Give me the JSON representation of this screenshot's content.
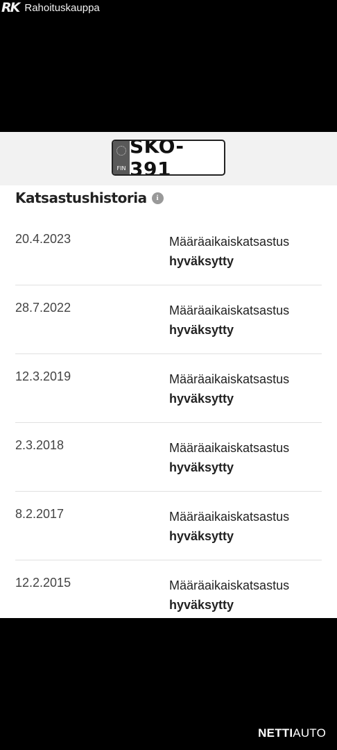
{
  "header": {
    "logo_mark": "RK",
    "logo_text": "Rahoituskauppa"
  },
  "plate": {
    "country": "FIN",
    "number": "SKO-391"
  },
  "section": {
    "title": "Katsastushistoria",
    "info_icon": "info-icon"
  },
  "inspections": [
    {
      "date": "20.4.2023",
      "type": "Määräaikaiskatsastus",
      "status": "hyväksytty"
    },
    {
      "date": "28.7.2022",
      "type": "Määräaikaiskatsastus",
      "status": "hyväksytty"
    },
    {
      "date": "12.3.2019",
      "type": "Määräaikaiskatsastus",
      "status": "hyväksytty"
    },
    {
      "date": "2.3.2018",
      "type": "Määräaikaiskatsastus",
      "status": "hyväksytty"
    },
    {
      "date": "8.2.2017",
      "type": "Määräaikaiskatsastus",
      "status": "hyväksytty"
    },
    {
      "date": "12.2.2015",
      "type": "Määräaikaiskatsastus",
      "status": "hyväksytty"
    }
  ],
  "footer": {
    "brand_bold": "NETTI",
    "brand_rest": "AUTO"
  }
}
